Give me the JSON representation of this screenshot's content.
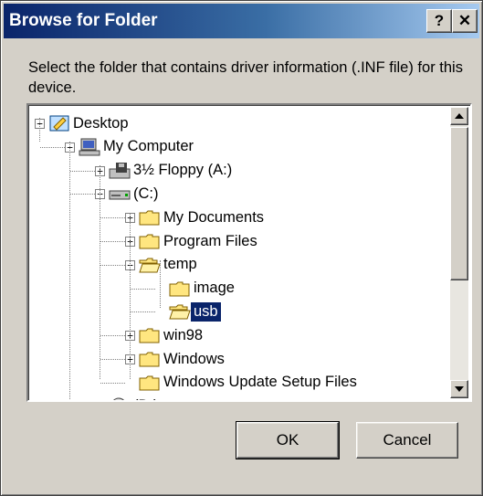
{
  "window": {
    "title": "Browse for Folder",
    "help_glyph": "?",
    "close_glyph": "✕"
  },
  "instructions": "Select the folder that contains driver information (.INF file) for this device.",
  "tree": [
    {
      "label": "Desktop",
      "icon": "desktop-icon",
      "expander": "−"
    },
    {
      "label": "My Computer",
      "icon": "computer-icon",
      "expander": "−"
    },
    {
      "label": "3½ Floppy (A:)",
      "icon": "floppy-drive-icon",
      "expander": "+"
    },
    {
      "label": "(C:)",
      "icon": "hard-drive-icon",
      "expander": "−"
    },
    {
      "label": "My Documents",
      "icon": "folder-icon",
      "expander": "+"
    },
    {
      "label": "Program Files",
      "icon": "folder-icon",
      "expander": "+"
    },
    {
      "label": "temp",
      "icon": "folder-open-icon",
      "expander": "−"
    },
    {
      "label": "image",
      "icon": "folder-icon",
      "expander": ""
    },
    {
      "label": "usb",
      "icon": "folder-open-icon",
      "expander": "",
      "selected": true
    },
    {
      "label": "win98",
      "icon": "folder-icon",
      "expander": "+"
    },
    {
      "label": "Windows",
      "icon": "folder-icon",
      "expander": "+"
    },
    {
      "label": "Windows Update Setup Files",
      "icon": "folder-icon",
      "expander": ""
    },
    {
      "label": "(D:)",
      "icon": "cd-drive-icon",
      "expander": "+"
    }
  ],
  "buttons": {
    "ok": "OK",
    "cancel": "Cancel"
  },
  "colors": {
    "titlebar_start": "#0a246a",
    "titlebar_end": "#a6caf0",
    "face": "#d4d0c8",
    "selection": "#0a246a"
  }
}
